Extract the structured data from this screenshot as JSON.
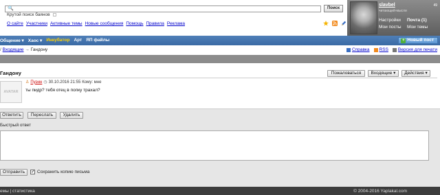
{
  "header": {
    "search_placeholder": "",
    "search_button": "Поиск",
    "tagline": "Крутой поиск баянов",
    "links": [
      "О сайте",
      "Участники",
      "Активные темы",
      "Новые сообщения",
      "Помощь",
      "Правила",
      "Реклама"
    ]
  },
  "user": {
    "username": "slavbel",
    "rank": "читающий-мысли",
    "points": "49",
    "settings": "Настройки",
    "mail": "Почта (1)",
    "my_posts": "Мои посты",
    "my_topics": "Мои темы"
  },
  "nav": {
    "items": [
      "Общение ▾",
      "Хаос ▾",
      "Инкубатор",
      "Арт",
      "ЯП файлы"
    ],
    "new_post": "Новый пост"
  },
  "breadcrumb": {
    "lead": "/",
    "inbox": "Входящие",
    "current": "Гандону"
  },
  "page_links": {
    "help": "Справка",
    "rss": "RSS",
    "print": "Версия для печати"
  },
  "message": {
    "title": "Гандону",
    "complain": "Пожаловаться",
    "inbox_menu": "Входящие ▾",
    "actions_menu": "Действия ▾",
    "avatar_text": "AVATAR",
    "author": "Пуэнн",
    "date": "30.10.2016 21:55",
    "to": "Кому: мне",
    "body": "ты пидр? тебя отец в попку трахал?"
  },
  "actions": {
    "reply": "Ответить",
    "forward": "Переслать",
    "delete": "Удалить",
    "quick_reply": "Быстрый ответ",
    "send": "Отправить",
    "save_copy": "Сохранить копию письма"
  },
  "footer": {
    "left": "емы | статистика",
    "right": "© 2004-2016 Yaplakal.com"
  },
  "colors": {
    "nav_bg": "#4576b0",
    "nav_active": "#ffd200",
    "link": "#0000cc",
    "footer_bg": "#3c3c3c"
  }
}
